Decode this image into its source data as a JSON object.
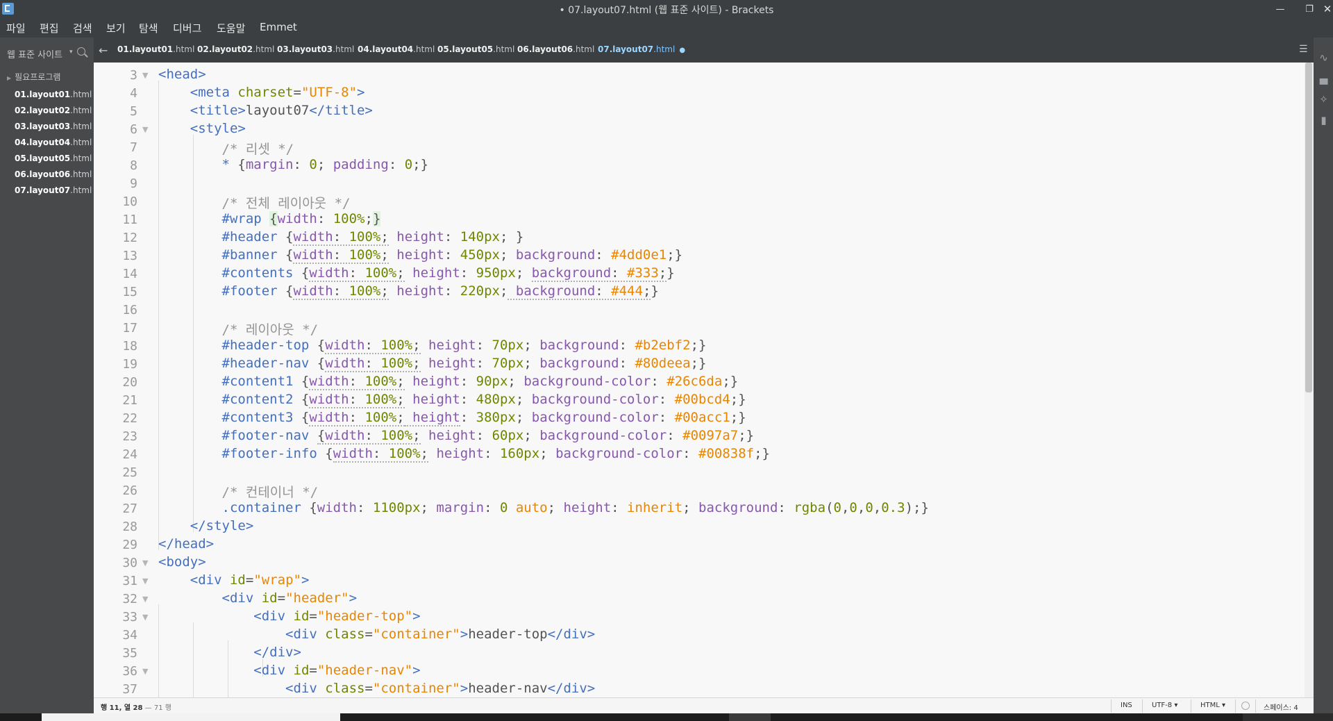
{
  "window": {
    "title": "• 07.layout07.html (웹 표준 사이트) - Brackets",
    "controls": [
      "—",
      "❐",
      "✕"
    ]
  },
  "menu": [
    "파일",
    "편집",
    "검색",
    "보기",
    "탐색",
    "디버그",
    "도움말",
    "Emmet"
  ],
  "sidebar": {
    "project": "웹 표준 사이트",
    "folder": "필요프로그램",
    "files": [
      {
        "name": "01.layout01",
        "ext": ".html"
      },
      {
        "name": "02.layout02",
        "ext": ".html"
      },
      {
        "name": "03.layout03",
        "ext": ".html"
      },
      {
        "name": "04.layout04",
        "ext": ".html"
      },
      {
        "name": "05.layout05",
        "ext": ".html"
      },
      {
        "name": "06.layout06",
        "ext": ".html"
      },
      {
        "name": "07.layout07",
        "ext": ".html"
      }
    ]
  },
  "tabs": [
    {
      "name": "01.layout01",
      "ext": ".html"
    },
    {
      "name": "02.layout02",
      "ext": ".html"
    },
    {
      "name": "03.layout03",
      "ext": ".html"
    },
    {
      "name": "04.layout04",
      "ext": ".html"
    },
    {
      "name": "05.layout05",
      "ext": ".html"
    },
    {
      "name": "06.layout06",
      "ext": ".html"
    },
    {
      "name": "07.layout07",
      "ext": ".html",
      "active": true,
      "dirty": "●"
    }
  ],
  "tab_bar": {
    "back": "←",
    "menu": "☰"
  },
  "toolbar_icons": [
    "live-preview-icon",
    "extension-manager-icon",
    "wand-icon",
    "book-icon"
  ],
  "editor": {
    "line_numbers": [
      "3",
      "4",
      "5",
      "6",
      "7",
      "8",
      "9",
      "10",
      "11",
      "12",
      "13",
      "14",
      "15",
      "16",
      "17",
      "18",
      "19",
      "20",
      "21",
      "22",
      "23",
      "24",
      "25",
      "26",
      "27",
      "28",
      "29",
      "30",
      "31",
      "32",
      "33",
      "34",
      "35",
      "36",
      "37"
    ],
    "fold_markers": [
      "▼",
      "▼",
      "▼",
      "▼",
      "▼",
      "▼",
      "▼"
    ]
  },
  "statusbar": {
    "cursor": "행 11, 열 28",
    "lines": "— 71 행",
    "mode": "INS",
    "encoding": "UTF-8 ▾",
    "language": "HTML ▾",
    "indent": "스페이스: 4"
  },
  "colors": {
    "chrome": "#3c3f41",
    "sidebar": "#47494b",
    "editor_bg": "#f8f8f8",
    "tag": "#446fbd",
    "attribute": "#6d8600",
    "string": "#e88501",
    "comment": "#949494",
    "property": "#8757ad",
    "active_tab": "#7dc4ff"
  }
}
